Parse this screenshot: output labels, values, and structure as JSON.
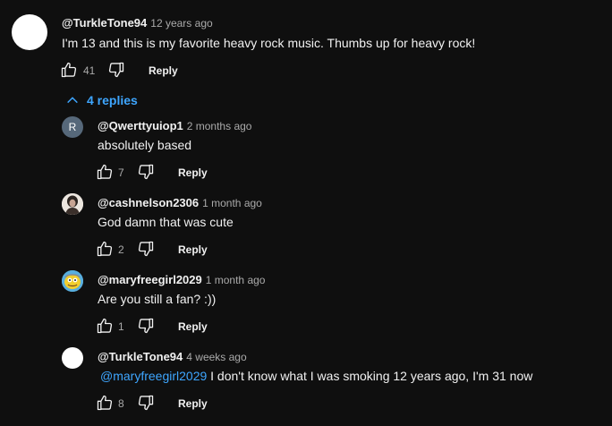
{
  "top_comment": {
    "handle": "@TurkleTone94",
    "time": "12 years ago",
    "text": "I'm 13 and this is my favorite heavy rock music. Thumbs up for heavy rock!",
    "likes": "41",
    "reply_label": "Reply"
  },
  "replies_toggle": {
    "label": "4 replies"
  },
  "replies": [
    {
      "handle": "@Qwerttyuiop1",
      "time": "2 months ago",
      "text": "absolutely based",
      "likes": "7",
      "reply_label": "Reply",
      "avatar_letter": "R",
      "avatar_color": "#56687a"
    },
    {
      "handle": "@cashnelson2306",
      "time": "1 month ago",
      "text": "God damn that was cute",
      "likes": "2",
      "reply_label": "Reply"
    },
    {
      "handle": "@maryfreegirl2029",
      "time": "1 month ago",
      "text": "Are you still a fan? :))",
      "likes": "1",
      "reply_label": "Reply"
    },
    {
      "handle": "@TurkleTone94",
      "time": "4 weeks ago",
      "mention": "@maryfreegirl2029",
      "text": " I don't know what I was smoking 12 years ago, I'm 31 now",
      "likes": "8",
      "reply_label": "Reply"
    }
  ]
}
